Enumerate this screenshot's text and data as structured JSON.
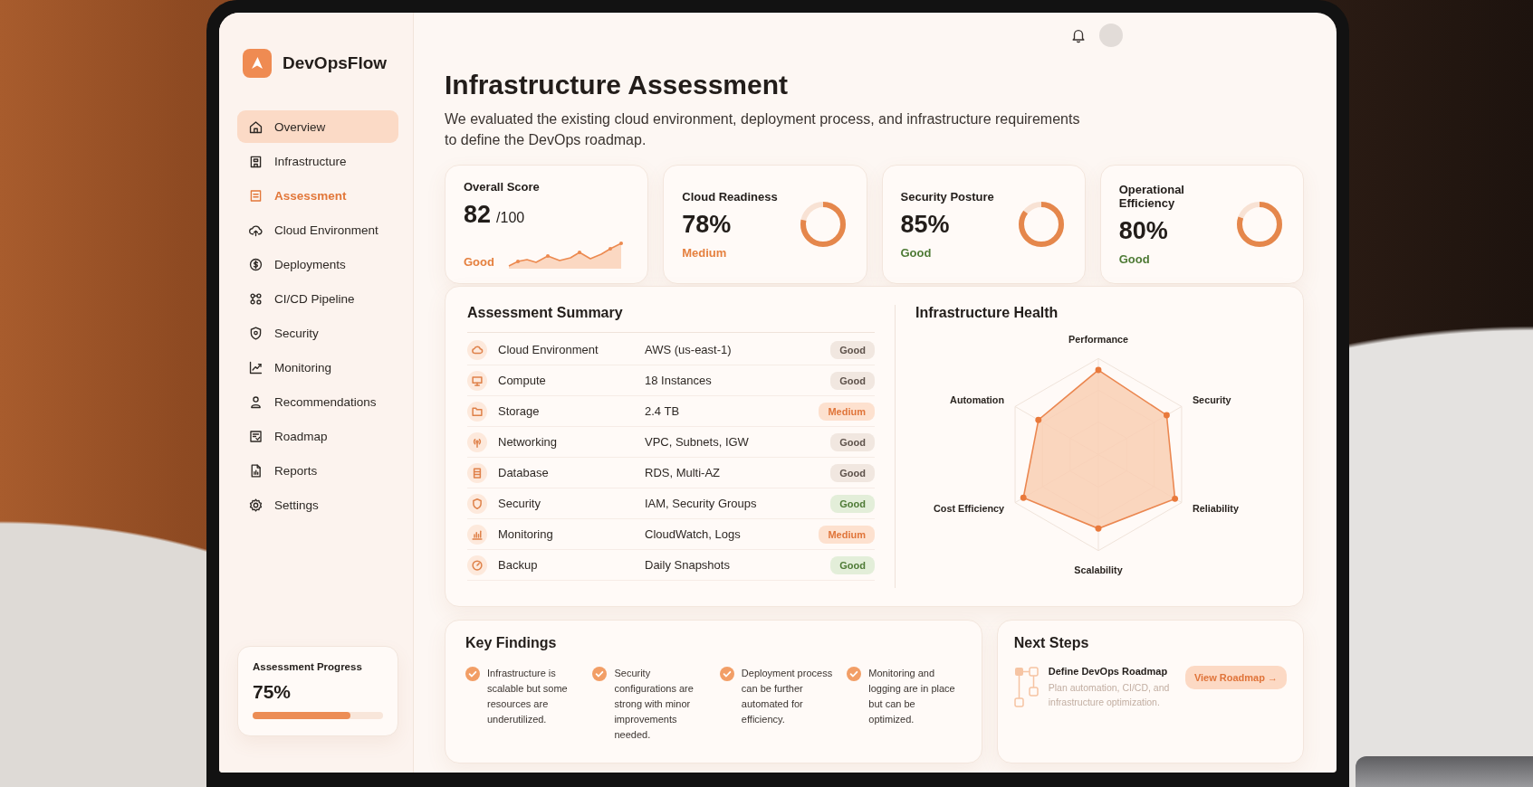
{
  "app": {
    "name": "DevOpsFlow"
  },
  "sidebar": {
    "items": [
      {
        "label": "Overview",
        "selected": true,
        "active": false
      },
      {
        "label": "Infrastructure",
        "selected": false,
        "active": false
      },
      {
        "label": "Assessment",
        "selected": false,
        "active": true
      },
      {
        "label": "Cloud Environment",
        "selected": false,
        "active": false
      },
      {
        "label": "Deployments",
        "selected": false,
        "active": false
      },
      {
        "label": "CI/CD Pipeline",
        "selected": false,
        "active": false
      },
      {
        "label": "Security",
        "selected": false,
        "active": false
      },
      {
        "label": "Monitoring",
        "selected": false,
        "active": false
      },
      {
        "label": "Recommendations",
        "selected": false,
        "active": false
      },
      {
        "label": "Roadmap",
        "selected": false,
        "active": false
      },
      {
        "label": "Reports",
        "selected": false,
        "active": false
      },
      {
        "label": "Settings",
        "selected": false,
        "active": false
      }
    ],
    "progress": {
      "title": "Assessment Progress",
      "value": "75%",
      "level": 0.75
    }
  },
  "header": {
    "title": "Infrastructure Assessment",
    "description": "We evaluated the existing cloud environment, deployment process, and infrastructure requirements to define the DevOps roadmap."
  },
  "score_cards": [
    {
      "kind": "sparkline",
      "title": "Overall Score",
      "value": "82",
      "suffix": "/100",
      "status": {
        "label": "Good",
        "kind": "accent"
      }
    },
    {
      "kind": "ring",
      "title": "Cloud Readiness",
      "value": "78%",
      "level": 0.78,
      "status": {
        "label": "Medium",
        "kind": "accent"
      }
    },
    {
      "kind": "ring",
      "title": "Security Posture",
      "value": "85%",
      "level": 0.85,
      "status": {
        "label": "Good",
        "kind": "positive"
      }
    },
    {
      "kind": "ring",
      "title": "Operational Efficiency",
      "value": "80%",
      "level": 0.8,
      "status": {
        "label": "Good",
        "kind": "positive"
      }
    }
  ],
  "assessment_summary": {
    "title": "Assessment Summary",
    "rows": [
      {
        "name": "Cloud Environment",
        "value": "AWS (us-east-1)",
        "status": {
          "label": "Good",
          "kind": "neutral"
        }
      },
      {
        "name": "Compute",
        "value": "18 Instances",
        "status": {
          "label": "Good",
          "kind": "neutral"
        }
      },
      {
        "name": "Storage",
        "value": "2.4 TB",
        "status": {
          "label": "Medium",
          "kind": "warning"
        }
      },
      {
        "name": "Networking",
        "value": "VPC, Subnets, IGW",
        "status": {
          "label": "Good",
          "kind": "neutral"
        }
      },
      {
        "name": "Database",
        "value": "RDS, Multi-AZ",
        "status": {
          "label": "Good",
          "kind": "neutral"
        }
      },
      {
        "name": "Security",
        "value": "IAM, Security Groups",
        "status": {
          "label": "Good",
          "kind": "positive"
        }
      },
      {
        "name": "Monitoring",
        "value": "CloudWatch, Logs",
        "status": {
          "label": "Medium",
          "kind": "warning"
        }
      },
      {
        "name": "Backup",
        "value": "Daily Snapshots",
        "status": {
          "label": "Good",
          "kind": "positive"
        }
      }
    ]
  },
  "infrastructure_health": {
    "title": "Infrastructure Health",
    "axes": [
      "Performance",
      "Security",
      "Automation",
      "Reliability",
      "Cost Efficiency",
      "Scalability"
    ]
  },
  "key_findings": {
    "title": "Key Findings",
    "items": [
      "Infrastructure is scalable but some resources are underutilized.",
      "Security configurations are strong with minor improvements needed.",
      "Deployment process can be further automated for efficiency.",
      "Monitoring and logging are in place but can be optimized."
    ]
  },
  "next_steps": {
    "title": "Next Steps",
    "items": [
      {
        "title": "Define DevOps Roadmap",
        "description": "Plan automation, CI/CD, and infrastructure optimization.",
        "action": "View Roadmap →"
      }
    ]
  }
}
